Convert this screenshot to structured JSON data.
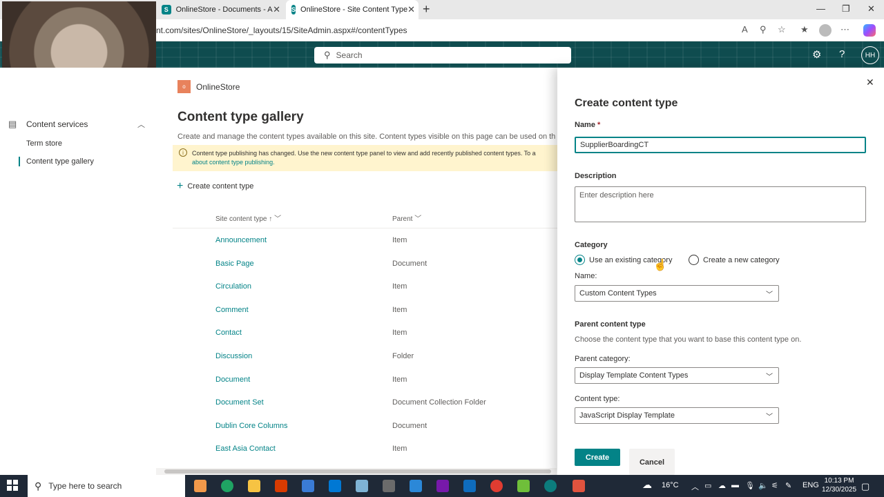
{
  "browser": {
    "tabs": [
      {
        "title": "OnlineStore - Documents - All Do",
        "active": false
      },
      {
        "title": "OnlineStore - Site Content Type",
        "active": true
      }
    ],
    "url": "nt.com/sites/OnlineStore/_layouts/15/SiteAdmin.aspx#/contentTypes"
  },
  "header": {
    "search_placeholder": "Search",
    "user_initials": "HH"
  },
  "leftnav": {
    "group_label": "Content services",
    "items": [
      "Term store",
      "Content type gallery"
    ],
    "selected": "Content type gallery"
  },
  "site": {
    "logo_letter": "o",
    "name": "OnlineStore"
  },
  "main": {
    "title": "Content type gallery",
    "description": "Create and manage the content types available on this site. Content types visible on this page can be used on th",
    "banner_text": "Content type publishing has changed. Use the new content type panel to view and add recently published content types. To a",
    "banner_link": "about content type publishing.",
    "create_label": "Create content type",
    "columns": {
      "name": "Site content type",
      "parent": "Parent"
    },
    "rows": [
      {
        "name": "Announcement",
        "parent": "Item"
      },
      {
        "name": "Basic Page",
        "parent": "Document"
      },
      {
        "name": "Circulation",
        "parent": "Item"
      },
      {
        "name": "Comment",
        "parent": "Item"
      },
      {
        "name": "Contact",
        "parent": "Item"
      },
      {
        "name": "Discussion",
        "parent": "Folder"
      },
      {
        "name": "Document",
        "parent": "Item"
      },
      {
        "name": "Document Set",
        "parent": "Document Collection Folder"
      },
      {
        "name": "Dublin Core Columns",
        "parent": "Document"
      },
      {
        "name": "East Asia Contact",
        "parent": "Item"
      }
    ]
  },
  "panel": {
    "title": "Create content type",
    "name_label": "Name",
    "required_mark": "*",
    "name_value": "SupplierBoardingCT",
    "description_label": "Description",
    "description_placeholder": "Enter description here",
    "category_label": "Category",
    "radio_existing": "Use an existing category",
    "radio_new": "Create a new category",
    "category_name_label": "Name:",
    "category_name_value": "Custom Content Types",
    "parent_section_label": "Parent content type",
    "parent_section_hint": "Choose the content type that you want to base this content type on.",
    "parent_category_label": "Parent category:",
    "parent_category_value": "Display Template Content Types",
    "content_type_label": "Content type:",
    "content_type_value": "JavaScript Display Template",
    "create_button": "Create",
    "cancel_button": "Cancel"
  },
  "taskbar": {
    "search_placeholder": "Type here to search",
    "temperature": "16°C",
    "language": "ENG",
    "time": "10:13 PM",
    "date": "12/30/2025"
  },
  "colors": {
    "accent": "#038387",
    "header_bg": "#0f4c4f",
    "banner_bg": "#fff4ce",
    "taskbar_bg": "#1f2937"
  }
}
